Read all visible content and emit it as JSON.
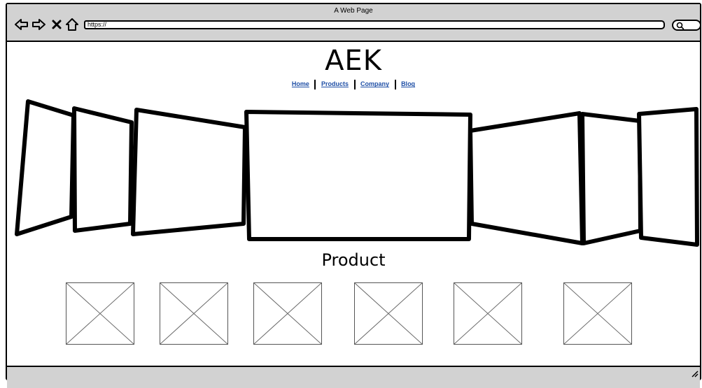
{
  "window": {
    "title": "A Web Page"
  },
  "browser": {
    "url": "https://",
    "icons": [
      "back-arrow-icon",
      "forward-arrow-icon",
      "close-icon",
      "home-icon",
      "search-icon"
    ]
  },
  "site": {
    "logo": "AEK",
    "nav": [
      {
        "label": "Home"
      },
      {
        "label": "Products"
      },
      {
        "label": "Company"
      },
      {
        "label": "Blog"
      }
    ]
  },
  "carousel": {
    "slides": 7,
    "active": 4
  },
  "products": {
    "title": "Product",
    "items": [
      {
        "icon": "image-placeholder-icon"
      },
      {
        "icon": "image-placeholder-icon"
      },
      {
        "icon": "image-placeholder-icon"
      },
      {
        "icon": "image-placeholder-icon"
      },
      {
        "icon": "image-placeholder-icon"
      },
      {
        "icon": "image-placeholder-icon"
      }
    ]
  }
}
